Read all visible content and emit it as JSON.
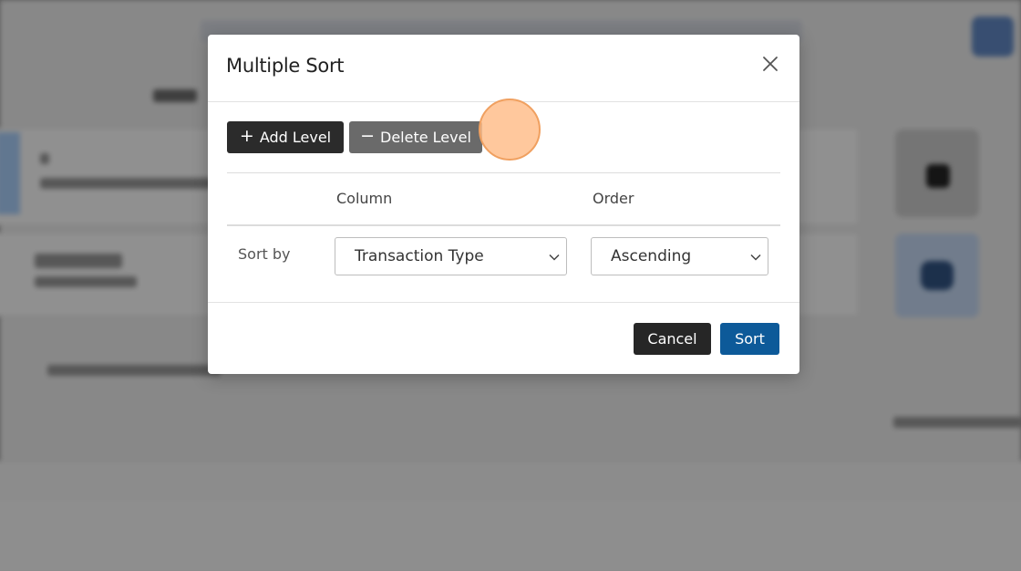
{
  "modal": {
    "title": "Multiple Sort",
    "add_level_label": "Add Level",
    "delete_level_label": "Delete Level",
    "table": {
      "headers": [
        "Column",
        "Order"
      ],
      "rows": [
        {
          "label": "Sort by",
          "column": "Transaction Type",
          "order": "Ascending"
        }
      ]
    },
    "cancel_label": "Cancel",
    "sort_label": "Sort"
  },
  "icons": {
    "close": "close-icon",
    "plus": "plus-icon",
    "minus": "minus-icon",
    "chevron": "chevron-down-icon"
  },
  "colors": {
    "add_button": "#2b2b2b",
    "delete_button": "#6a6a6a",
    "cancel_button": "#262626",
    "sort_button": "#0d5a99",
    "click_indicator": "#f0a060"
  }
}
